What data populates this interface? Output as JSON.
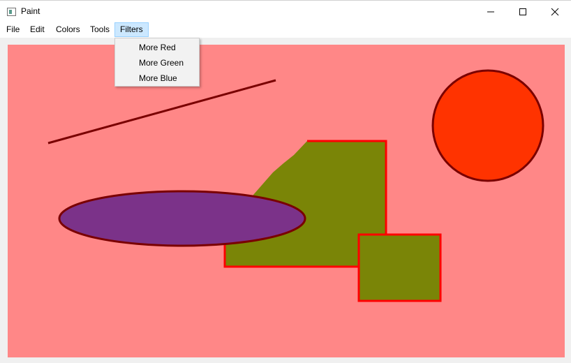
{
  "window": {
    "title": "Paint",
    "icon": "paint-app-icon"
  },
  "menu": {
    "items": [
      {
        "label": "File"
      },
      {
        "label": "Edit"
      },
      {
        "label": "Colors"
      },
      {
        "label": "Tools"
      },
      {
        "label": "Filters",
        "active": true
      }
    ]
  },
  "filters_menu": {
    "items": [
      {
        "label": "More Red"
      },
      {
        "label": "More Green"
      },
      {
        "label": "More Blue"
      }
    ]
  },
  "canvas": {
    "background": "#ff8787",
    "shapes": [
      {
        "kind": "line",
        "stroke": "#7a0000"
      },
      {
        "kind": "circle",
        "fill": "#ff3300",
        "stroke": "#7a0000"
      },
      {
        "kind": "polygon",
        "fill": "#7a8507",
        "stroke": "#ff0000"
      },
      {
        "kind": "ellipse",
        "fill": "#7b3289",
        "stroke": "#7a0000"
      },
      {
        "kind": "rectangle",
        "fill": "#7a8507",
        "stroke": "#ff0000"
      }
    ]
  }
}
